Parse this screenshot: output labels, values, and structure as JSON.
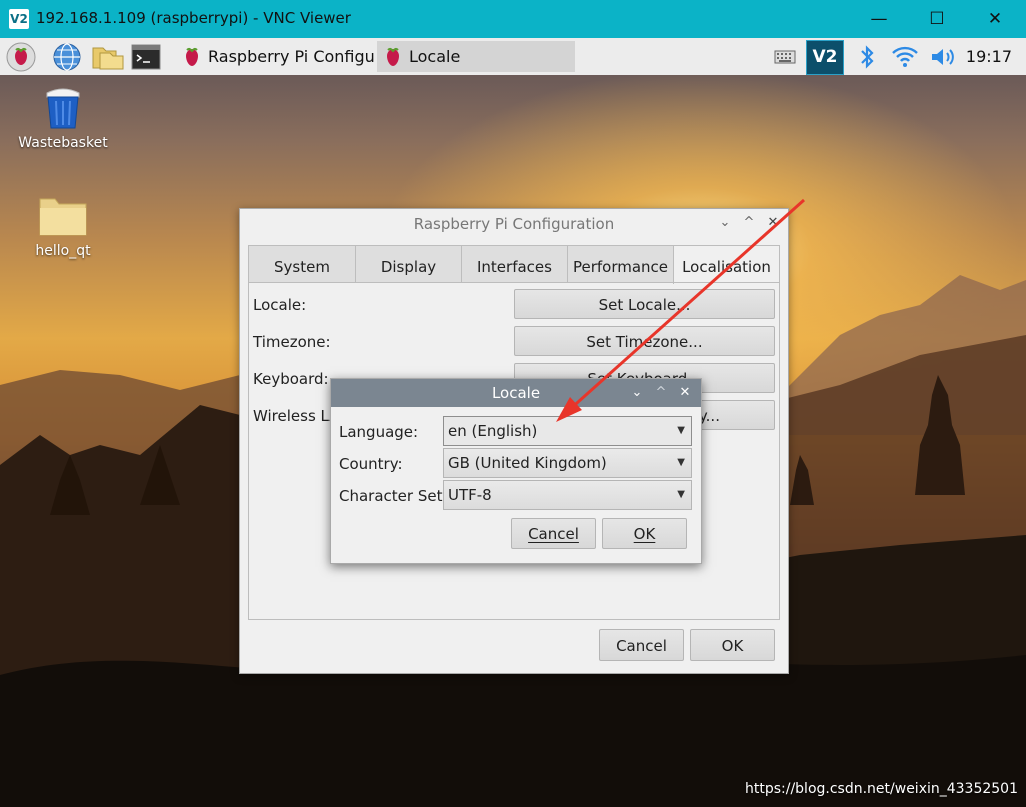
{
  "vnc": {
    "logo": "V2",
    "title": "192.168.1.109 (raspberrypi) - VNC Viewer",
    "minimize": "—",
    "maximize": "☐",
    "close": "✕"
  },
  "taskbar": {
    "tasks": [
      {
        "label": "Raspberry Pi Configu...",
        "icon": "raspberry-icon"
      },
      {
        "label": "Locale",
        "icon": "raspberry-icon"
      }
    ],
    "tray_vnc": "V2",
    "clock": "19:17"
  },
  "desktop": {
    "icons": [
      {
        "label": "Wastebasket",
        "icon": "trash-icon"
      },
      {
        "label": "hello_qt",
        "icon": "folder-icon"
      }
    ],
    "watermark": "https://blog.csdn.net/weixin_43352501"
  },
  "config_dialog": {
    "title": "Raspberry Pi Configuration",
    "tabs": [
      "System",
      "Display",
      "Interfaces",
      "Performance",
      "Localisation"
    ],
    "selected_tab": "Localisation",
    "rows": [
      {
        "label": "Locale:",
        "button": "Set Locale..."
      },
      {
        "label": "Timezone:",
        "button": "Set Timezone..."
      },
      {
        "label": "Keyboard:",
        "button": "Set Keyboard..."
      },
      {
        "label": "Wireless LAN Country:",
        "button": "Set WLAN Country..."
      }
    ],
    "cancel": "Cancel",
    "ok": "OK"
  },
  "locale_dialog": {
    "title": "Locale",
    "fields": [
      {
        "label": "Language:",
        "value": "en (English)"
      },
      {
        "label": "Country:",
        "value": "GB (United Kingdom)"
      },
      {
        "label": "Character Set:",
        "value": "UTF-8"
      }
    ],
    "cancel": "Cancel",
    "ok": "OK",
    "titlebar_color": "#7b8691"
  },
  "annotation": {
    "arrow_color": "#e8352a"
  }
}
